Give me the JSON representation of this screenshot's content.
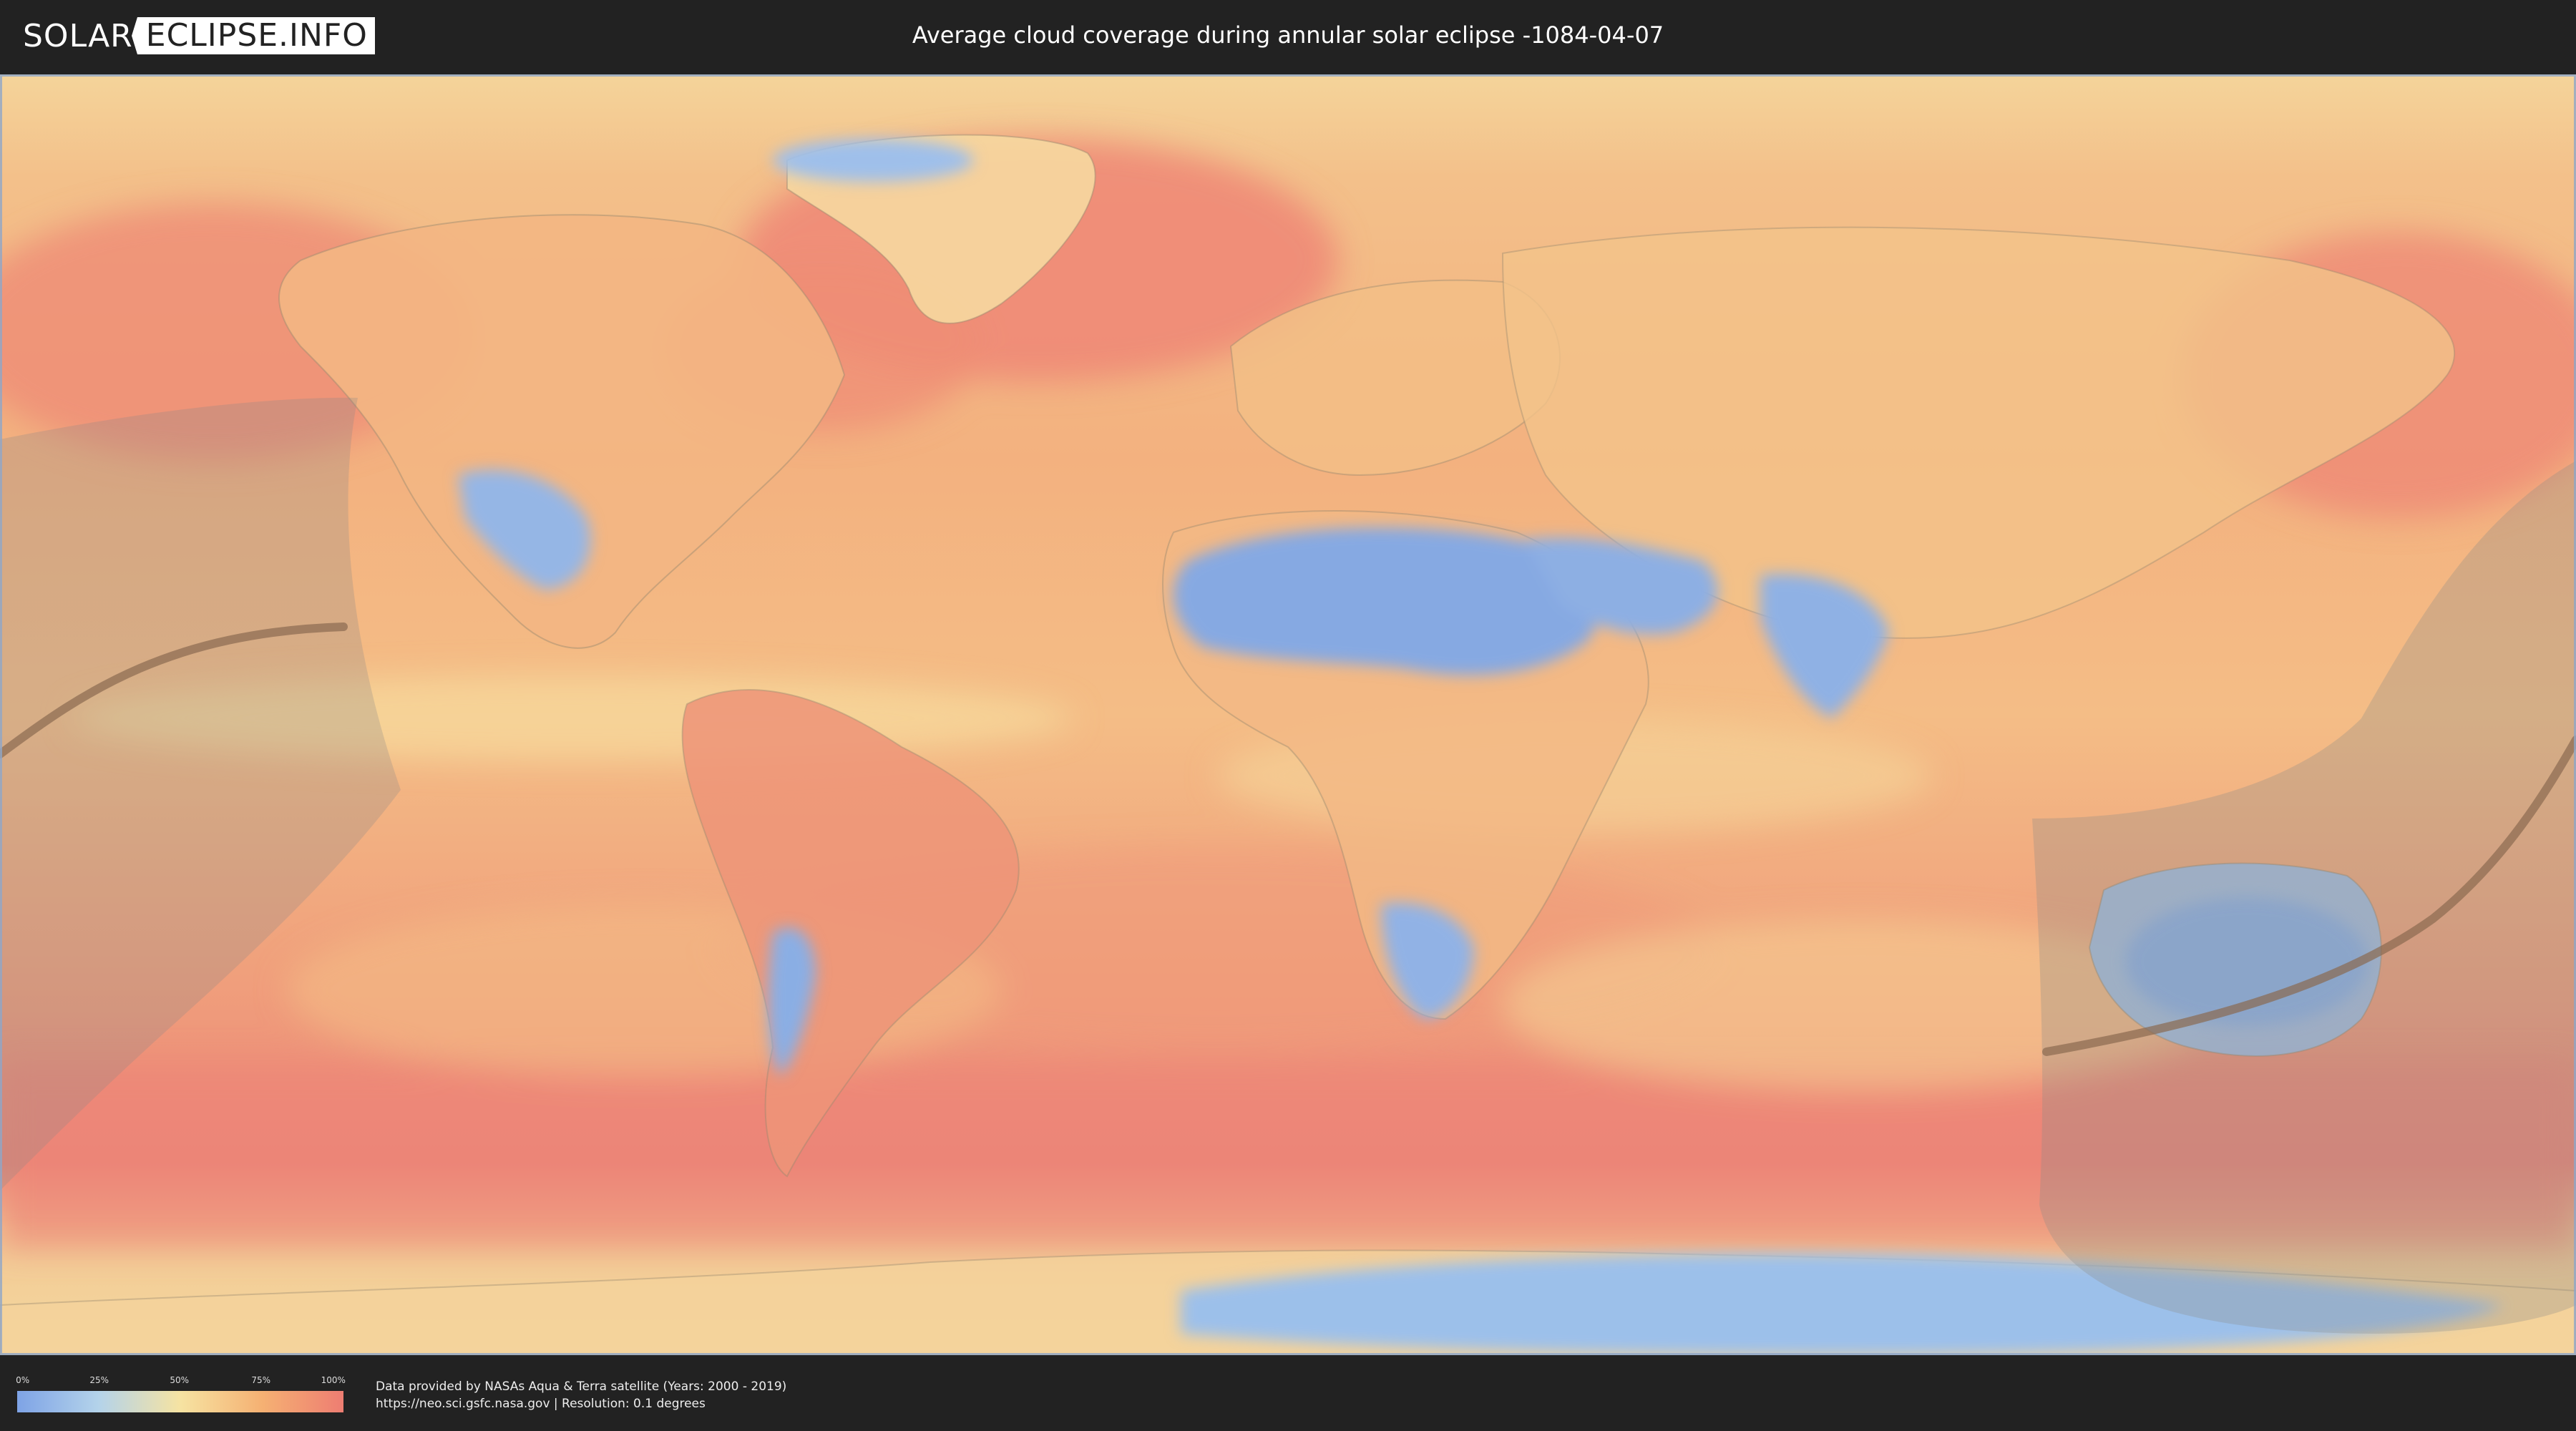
{
  "header": {
    "logo_left": "SOLAR",
    "logo_right": "ECLIPSE.INFO",
    "title": "Average cloud coverage during annular solar eclipse -1084-04-07"
  },
  "legend": {
    "ticks": [
      "0%",
      "25%",
      "50%",
      "75%",
      "100%"
    ],
    "colors": [
      "#7ea3e6",
      "#b4d3ea",
      "#f6e3a2",
      "#f5b173",
      "#ee7d72"
    ]
  },
  "credits": {
    "line1": "Data provided by NASAs Aqua & Terra satellite (Years: 2000 - 2019)",
    "line2": "https://neo.sci.gsfc.nasa.gov | Resolution: 0.1 degrees"
  },
  "map": {
    "palette": {
      "ocean_high": "#ee8a77",
      "ocean_mid": "#f5b87c",
      "desert": "#86a9e2",
      "ice": "#9dc0ea",
      "shadow": "#8c8a88",
      "path": "#8a6a50"
    }
  }
}
